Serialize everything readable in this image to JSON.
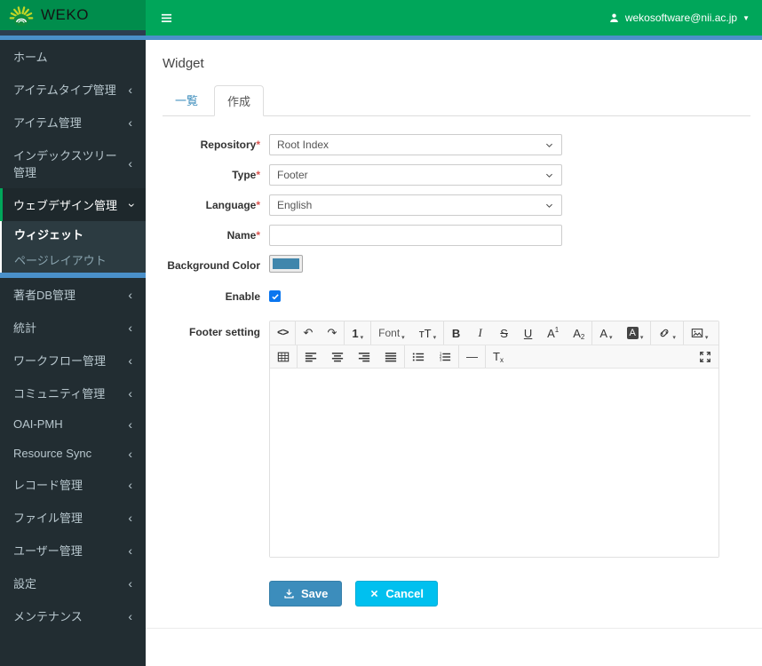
{
  "header": {
    "brand": "WEKO",
    "user_email": "wekosoftware@nii.ac.jp"
  },
  "sidebar": {
    "items_top": [
      {
        "label": "ホーム"
      },
      {
        "label": "アイテムタイプ管理",
        "chevron": true
      },
      {
        "label": "アイテム管理",
        "chevron": true
      },
      {
        "label": "インデックスツリー管理",
        "chevron": true
      }
    ],
    "expanded": {
      "label": "ウェブデザイン管理"
    },
    "submenu": [
      {
        "label": "ウィジェット",
        "active": true
      },
      {
        "label": "ページレイアウト"
      }
    ],
    "items_bottom": [
      {
        "label": "著者DB管理",
        "chevron": true
      },
      {
        "label": "統計",
        "chevron": true
      },
      {
        "label": "ワークフロー管理",
        "chevron": true
      },
      {
        "label": "コミュニティ管理",
        "chevron": true
      },
      {
        "label": "OAI-PMH",
        "chevron": true
      },
      {
        "label": "Resource Sync",
        "chevron": true
      },
      {
        "label": "レコード管理",
        "chevron": true
      },
      {
        "label": "ファイル管理",
        "chevron": true
      },
      {
        "label": "ユーザー管理",
        "chevron": true
      },
      {
        "label": "設定",
        "chevron": true
      },
      {
        "label": "メンテナンス",
        "chevron": true
      }
    ]
  },
  "main": {
    "title": "Widget",
    "tabs": {
      "list": "一覧",
      "create": "作成"
    },
    "form": {
      "required_mark": "*",
      "repository_label": "Repository",
      "repository_value": "Root Index",
      "type_label": "Type",
      "type_value": "Footer",
      "language_label": "Language",
      "language_value": "English",
      "name_label": "Name",
      "name_value": "",
      "bg_label": "Background Color",
      "bg_color": "#4086ac",
      "enable_label": "Enable",
      "enable_checked": true,
      "footer_label": "Footer setting"
    },
    "actions": {
      "save": "Save",
      "cancel": "Cancel"
    }
  },
  "editor": {
    "toolbar_row1": [
      {
        "t": "txt",
        "g": "<>",
        "cls": "mono",
        "n": "code-view-button"
      },
      {
        "t": "sep"
      },
      {
        "t": "txt",
        "g": "↶",
        "n": "undo-button"
      },
      {
        "t": "txt",
        "g": "↷",
        "n": "redo-button"
      },
      {
        "t": "sep"
      },
      {
        "t": "txt",
        "g": "1",
        "cls": "bold",
        "caret": true,
        "n": "paragraph-style-button"
      },
      {
        "t": "sep"
      },
      {
        "t": "txt",
        "g": "Font",
        "cls": "label",
        "caret": true,
        "n": "font-family-button"
      },
      {
        "t": "txt",
        "g": "тT",
        "caret": true,
        "n": "font-size-button"
      },
      {
        "t": "sep"
      },
      {
        "t": "txt",
        "g": "B",
        "cls": "bold",
        "n": "bold-button"
      },
      {
        "t": "txt",
        "g": "I",
        "cls": "italic",
        "n": "italic-button"
      },
      {
        "t": "txt",
        "g": "S",
        "cls": "strike",
        "n": "strikethrough-button"
      },
      {
        "t": "txt",
        "g": "U",
        "cls": "underline",
        "n": "underline-button"
      },
      {
        "t": "txt",
        "g": "A",
        "small": "1",
        "pos": "sup",
        "n": "superscript-button"
      },
      {
        "t": "txt",
        "g": "A",
        "small": "2",
        "pos": "sub",
        "n": "subscript-button"
      },
      {
        "t": "sep"
      },
      {
        "t": "txt",
        "g": "A",
        "caret": true,
        "n": "font-color-button"
      },
      {
        "t": "txt",
        "g": "A",
        "cls": "inv",
        "caret": true,
        "n": "background-color-button"
      },
      {
        "t": "sep"
      },
      {
        "t": "svg",
        "icon": "ic-link",
        "caret": true,
        "n": "insert-link-button"
      },
      {
        "t": "sep"
      },
      {
        "t": "svg",
        "icon": "ic-image",
        "caret": true,
        "n": "insert-image-button"
      }
    ],
    "toolbar_row2": [
      {
        "t": "svg",
        "icon": "ic-table",
        "n": "insert-table-button"
      },
      {
        "t": "sep"
      },
      {
        "t": "svg",
        "icon": "ic-align-left",
        "n": "align-left-button"
      },
      {
        "t": "svg",
        "icon": "ic-align-center",
        "n": "align-center-button"
      },
      {
        "t": "svg",
        "icon": "ic-align-right",
        "n": "align-right-button"
      },
      {
        "t": "svg",
        "icon": "ic-align-justify",
        "n": "align-justify-button"
      },
      {
        "t": "sep"
      },
      {
        "t": "svg",
        "icon": "ic-list-ul",
        "n": "unordered-list-button"
      },
      {
        "t": "svg",
        "icon": "ic-list-ol",
        "n": "ordered-list-button"
      },
      {
        "t": "sep"
      },
      {
        "t": "txt",
        "g": "—",
        "n": "horizontal-rule-button"
      },
      {
        "t": "sep"
      },
      {
        "t": "txt",
        "g": "T",
        "small": "x",
        "pos": "sub",
        "n": "clear-format-button"
      },
      {
        "t": "spacer"
      },
      {
        "t": "svg",
        "icon": "ic-expand",
        "n": "fullscreen-button"
      }
    ]
  }
}
